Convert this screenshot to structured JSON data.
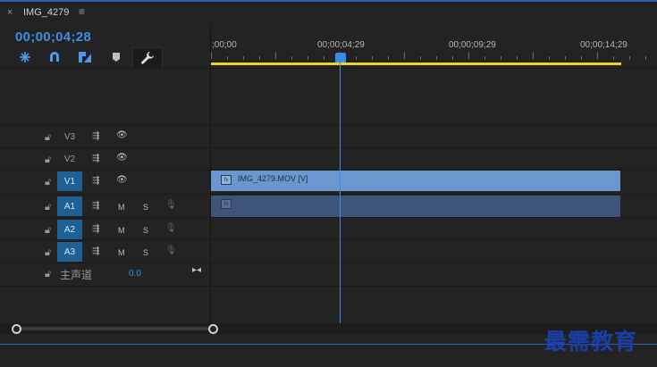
{
  "tab": {
    "close": "×",
    "title": "IMG_4279",
    "menu": "≡"
  },
  "timecode": "00;00;04;28",
  "ruler": {
    "labels": [
      ";00;00",
      "00;00;04;29",
      "00;00;09;29",
      "00;00;14;29"
    ]
  },
  "tracks": {
    "video": [
      {
        "name": "V3"
      },
      {
        "name": "V2"
      },
      {
        "name": "V1"
      }
    ],
    "audio": [
      {
        "name": "A1",
        "m": "M",
        "s": "S"
      },
      {
        "name": "A2",
        "m": "M",
        "s": "S"
      },
      {
        "name": "A3",
        "m": "M",
        "s": "S"
      }
    ]
  },
  "master": {
    "label": "主声道",
    "value": "0.0"
  },
  "clips": {
    "video_name": "IMG_4279.MOV [V]",
    "fx": "fx"
  },
  "watermark": "最需教育",
  "colors": {
    "accent": "#3d8ee6",
    "video_clip": "#6b97d0",
    "audio_clip": "#3e5478",
    "work_area": "#e8d42a"
  }
}
